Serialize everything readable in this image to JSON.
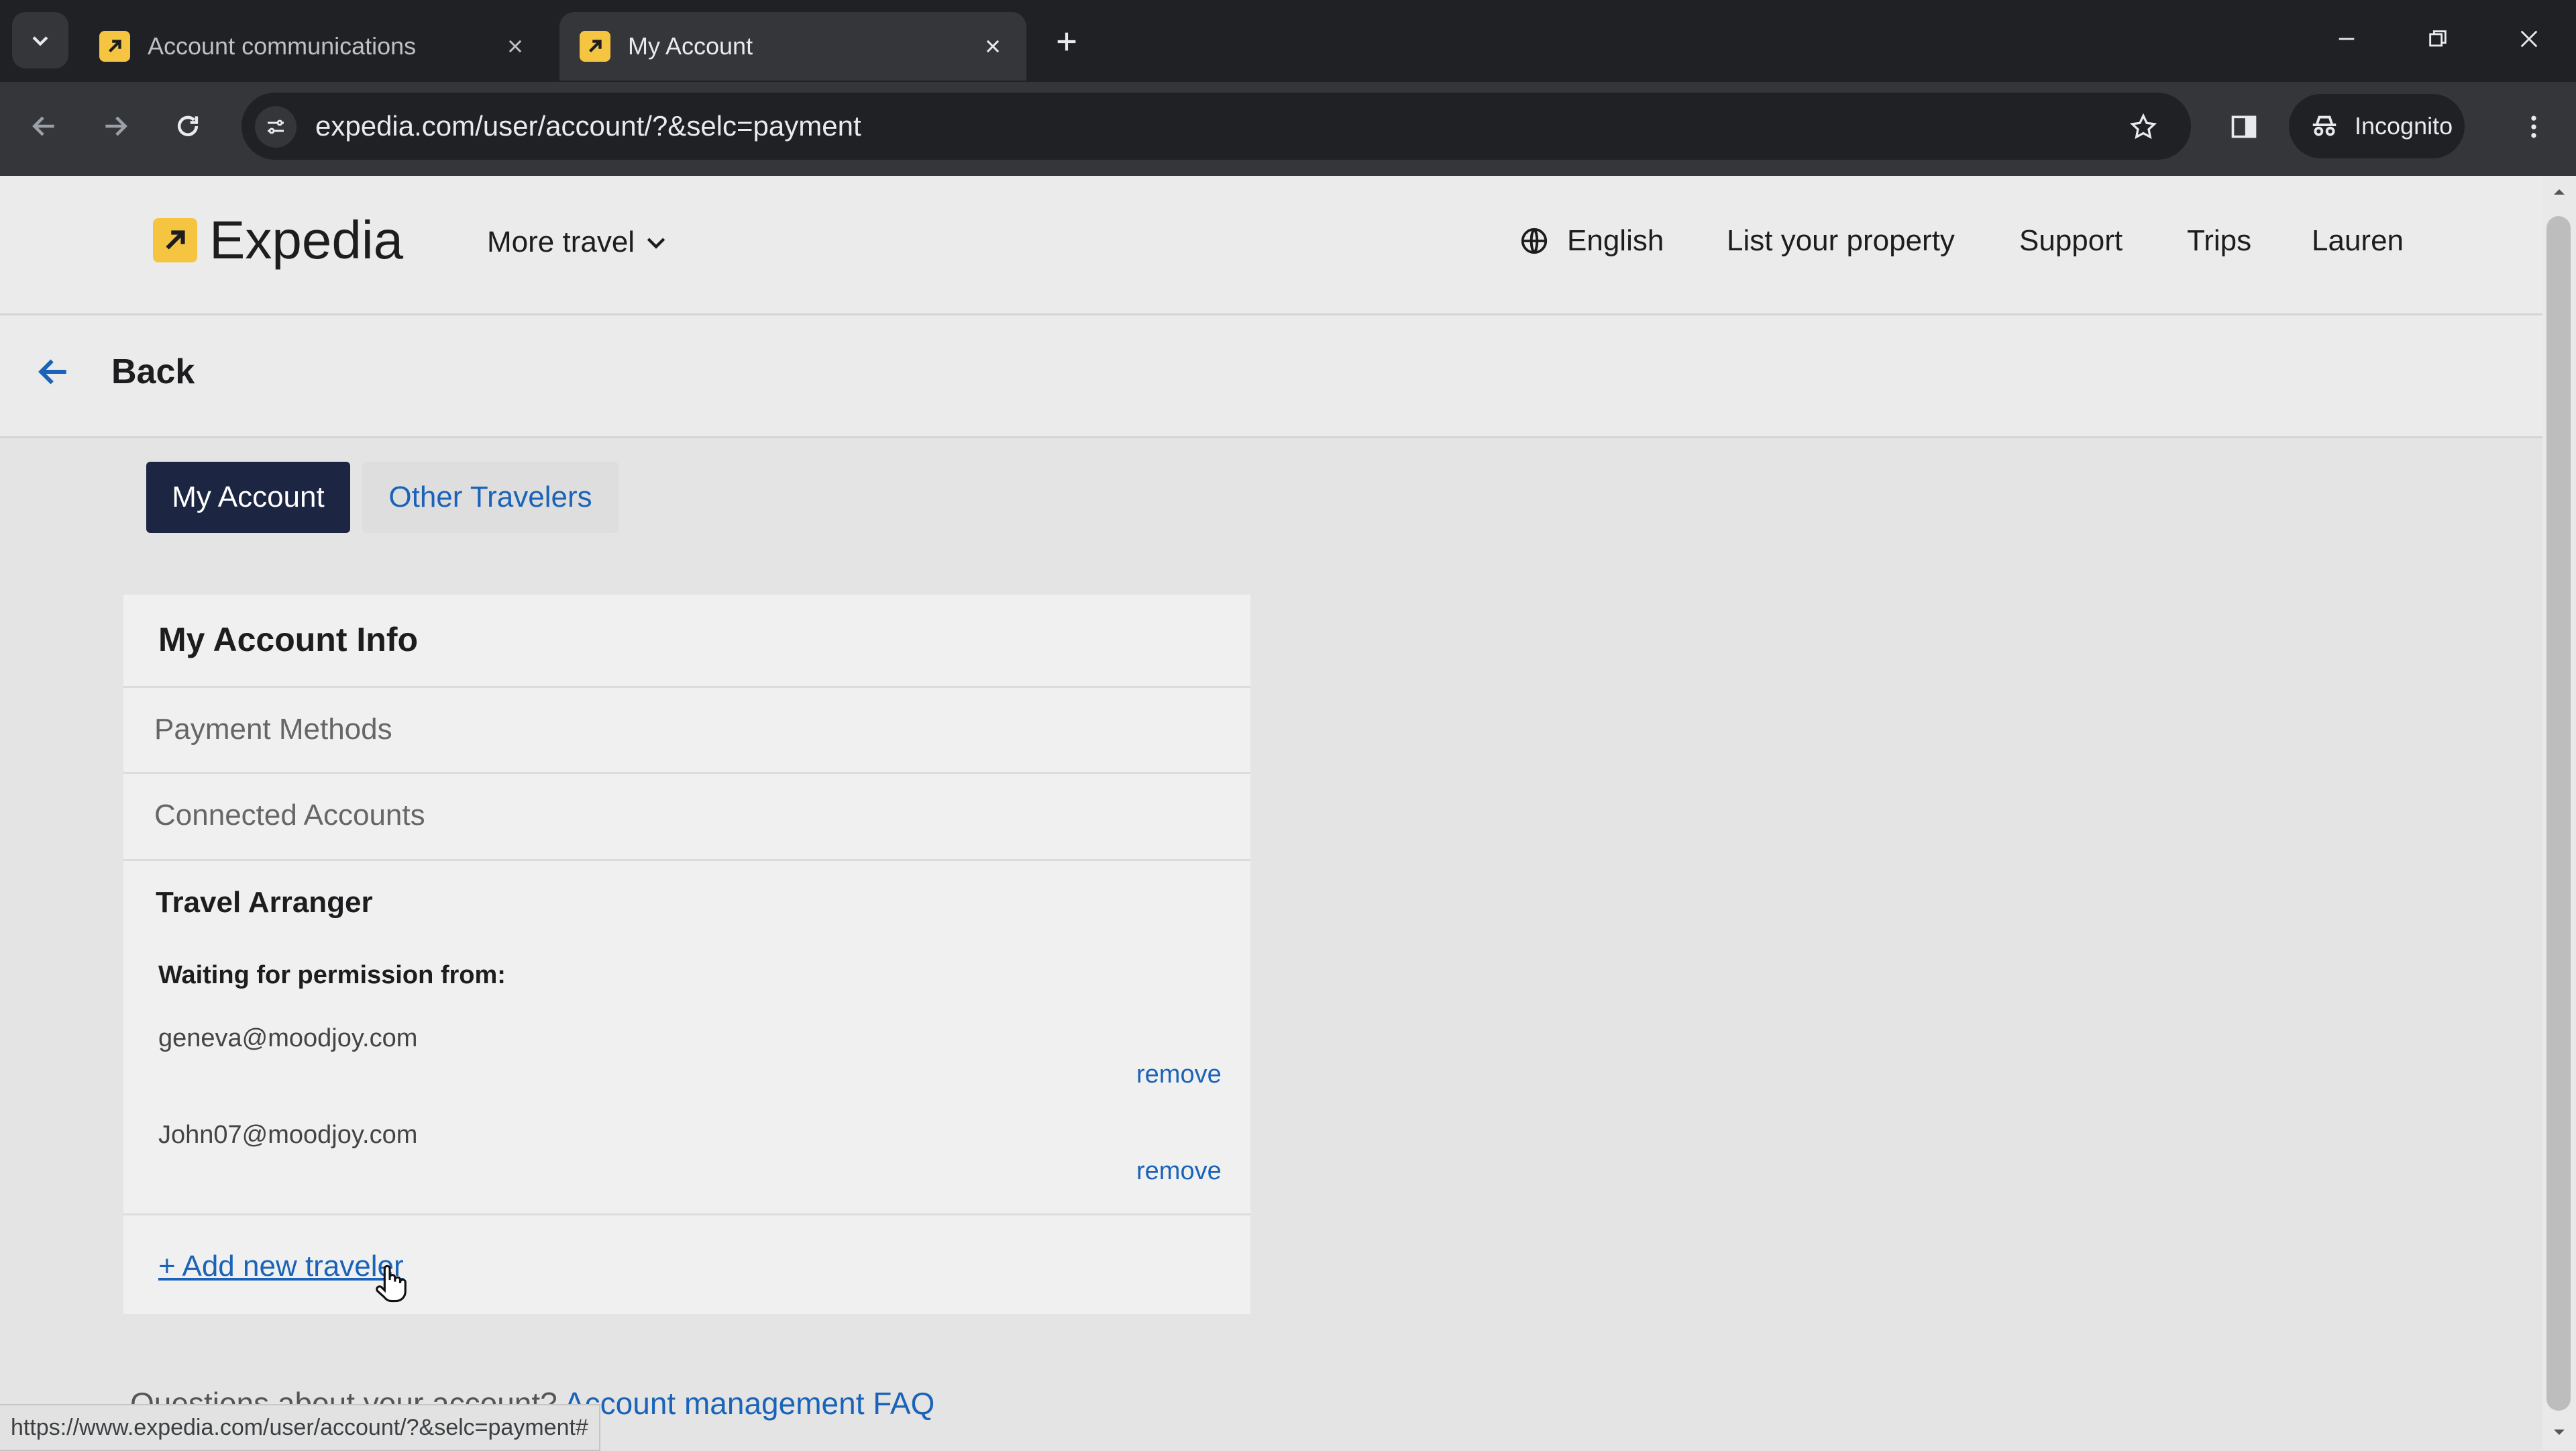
{
  "browser": {
    "tabs": [
      {
        "title": "Account communications"
      },
      {
        "title": "My Account"
      }
    ],
    "url": "expedia.com/user/account/?&selc=payment",
    "incognito_label": "Incognito"
  },
  "header": {
    "logo_text": "Expedia",
    "more_travel": "More travel",
    "language": "English",
    "list_property": "List your property",
    "support": "Support",
    "trips": "Trips",
    "user": "Lauren"
  },
  "back_label": "Back",
  "account_tabs": [
    {
      "label": "My Account"
    },
    {
      "label": "Other Travelers"
    }
  ],
  "card": {
    "title": "My Account Info",
    "payment_methods": "Payment Methods",
    "connected_accounts": "Connected Accounts",
    "travel_arranger": "Travel Arranger",
    "waiting_label": "Waiting for permission from:",
    "pending": [
      {
        "email": "geneva@moodjoy.com",
        "remove": "remove"
      },
      {
        "email": "John07@moodjoy.com",
        "remove": "remove"
      }
    ],
    "add_traveler": "+ Add new traveler"
  },
  "footer": {
    "question": "Questions about your account?",
    "faq_link": "Account management FAQ"
  },
  "status_url": "https://www.expedia.com/user/account/?&selc=payment#",
  "colors": {
    "brand_yellow": "#f5c542",
    "link_blue": "#1a63b8",
    "active_tab_bg": "#1c2541"
  }
}
